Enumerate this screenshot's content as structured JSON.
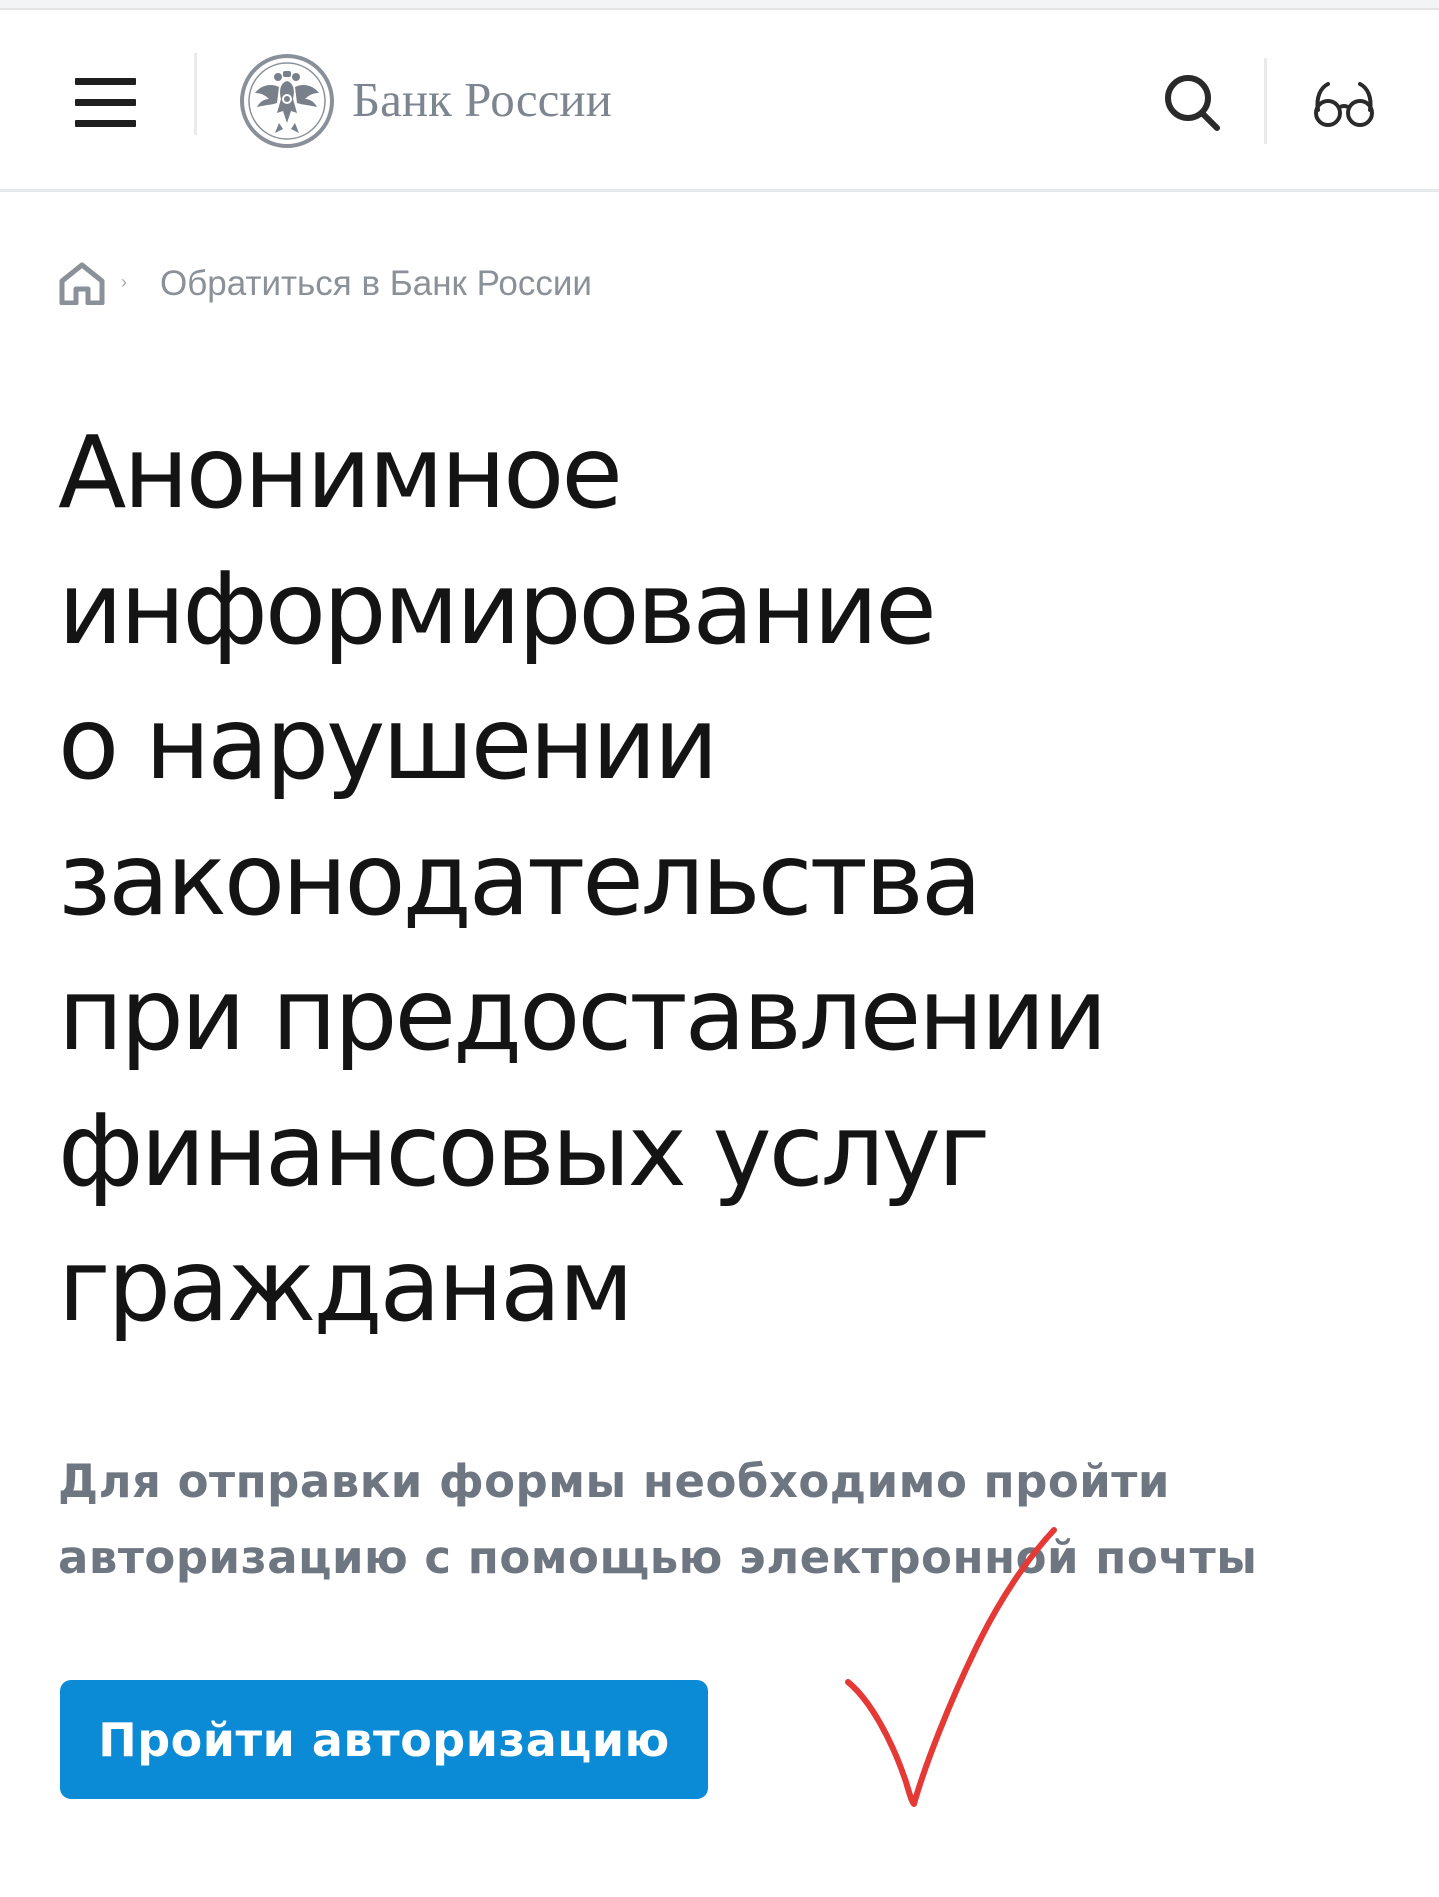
{
  "header": {
    "menu_icon": "hamburger-menu-icon",
    "logo_icon": "double-headed-eagle-emblem",
    "logo_text": "Банк России",
    "search_icon": "search-icon",
    "accessibility_icon": "glasses-icon"
  },
  "breadcrumb": {
    "home_icon": "home-icon",
    "separator": "›",
    "items": [
      {
        "label": "Обратиться в Банк России"
      }
    ]
  },
  "main": {
    "title_lines": [
      "Анонимное",
      "информирование",
      "о нарушении",
      "законодательства",
      "при предоставлении",
      "финансовых услуг",
      "гражданам"
    ],
    "description_lines": [
      "Для отправки формы необходимо пройти",
      "авторизацию с помощью электронной почты"
    ],
    "auth_button_label": "Пройти авторизацию"
  },
  "annotation": {
    "type": "hand-drawn-checkmark",
    "color": "#e53935"
  },
  "colors": {
    "accent": "#0b8bd6",
    "title_text": "#141414",
    "muted_text": "#6e7681",
    "logo_text": "#7d8590",
    "annotation": "#e53935"
  }
}
